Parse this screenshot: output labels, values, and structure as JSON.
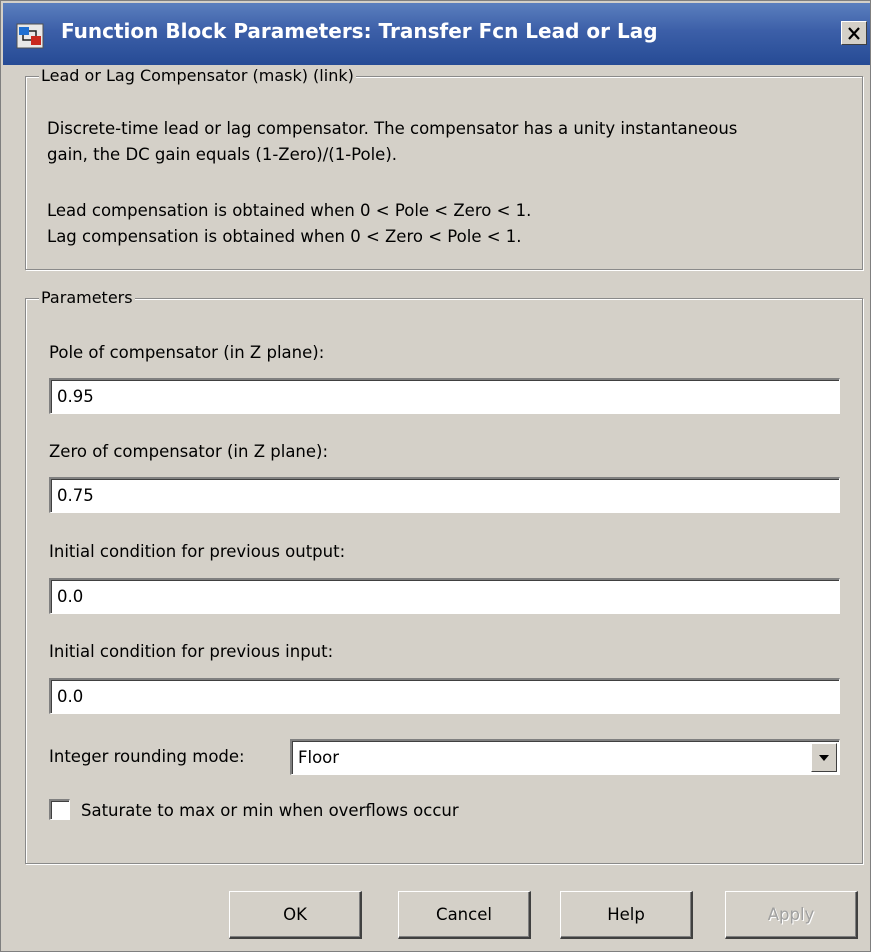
{
  "window": {
    "title": "Function Block Parameters: Transfer Fcn Lead or Lag",
    "icon": "simulink-block-icon",
    "close_label": "✕"
  },
  "description_group": {
    "legend": "Lead or Lag Compensator (mask) (link)",
    "lines": [
      "Discrete-time lead or lag compensator.  The compensator has a unity instantaneous",
      "gain, the DC gain equals (1-Zero)/(1-Pole).",
      "Lead compensation is obtained when 0 < Pole < Zero < 1.",
      "Lag compensation is obtained when 0 < Zero < Pole < 1."
    ]
  },
  "parameters_group": {
    "legend": "Parameters",
    "pole": {
      "label": "Pole of compensator (in Z plane):",
      "value": "0.95"
    },
    "zero": {
      "label": "Zero of compensator (in Z plane):",
      "value": "0.75"
    },
    "prev_output": {
      "label": "Initial condition for previous output:",
      "value": "0.0"
    },
    "prev_input": {
      "label": "Initial condition for previous input:",
      "value": "0.0"
    },
    "rounding": {
      "label": "Integer rounding mode:",
      "value": "Floor"
    },
    "saturate": {
      "label": "Saturate to max or min when overflows occur",
      "checked": false
    }
  },
  "buttons": {
    "ok": "OK",
    "cancel": "Cancel",
    "help": "Help",
    "apply": "Apply"
  },
  "colors": {
    "titlebar": "#3c5fa8",
    "dialog_bg": "#d4d0c8"
  }
}
